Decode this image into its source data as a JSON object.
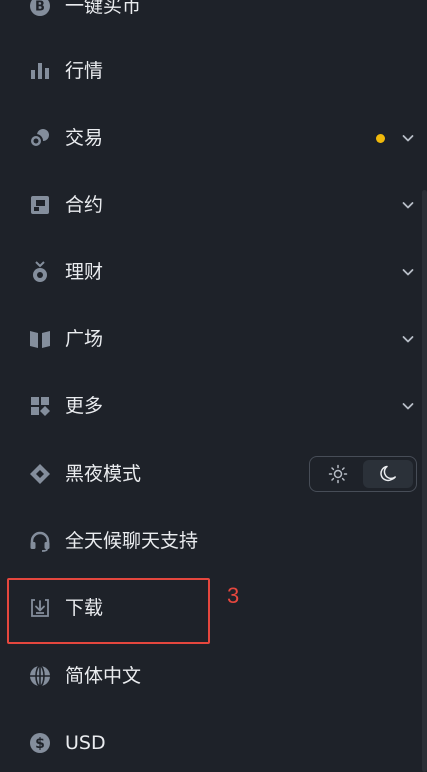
{
  "colors": {
    "background": "#1e2229",
    "text": "#eaecef",
    "icon": "#848e9c",
    "accent_dot": "#f0b90b",
    "annotation": "#e5473e"
  },
  "menu": {
    "items": [
      {
        "label": "一键买币",
        "icon": "coin-b-icon"
      },
      {
        "label": "行情",
        "icon": "bar-chart-icon"
      },
      {
        "label": "交易",
        "icon": "trade-icon",
        "has_dot": true,
        "has_chevron": true
      },
      {
        "label": "合约",
        "icon": "futures-icon",
        "has_chevron": true
      },
      {
        "label": "理财",
        "icon": "earn-icon",
        "has_chevron": true
      },
      {
        "label": "广场",
        "icon": "book-icon",
        "has_chevron": true
      },
      {
        "label": "更多",
        "icon": "grid-icon",
        "has_chevron": true
      },
      {
        "label": "黑夜模式",
        "icon": "diamond-icon"
      },
      {
        "label": "全天候聊天支持",
        "icon": "headset-icon"
      },
      {
        "label": "下载",
        "icon": "download-icon"
      },
      {
        "label": "简体中文",
        "icon": "globe-icon"
      },
      {
        "label": "USD",
        "icon": "dollar-icon"
      }
    ]
  },
  "theme_toggle": {
    "options": [
      "sun-icon",
      "moon-icon"
    ],
    "selected": "moon-icon"
  },
  "annotation": {
    "label": "3"
  }
}
